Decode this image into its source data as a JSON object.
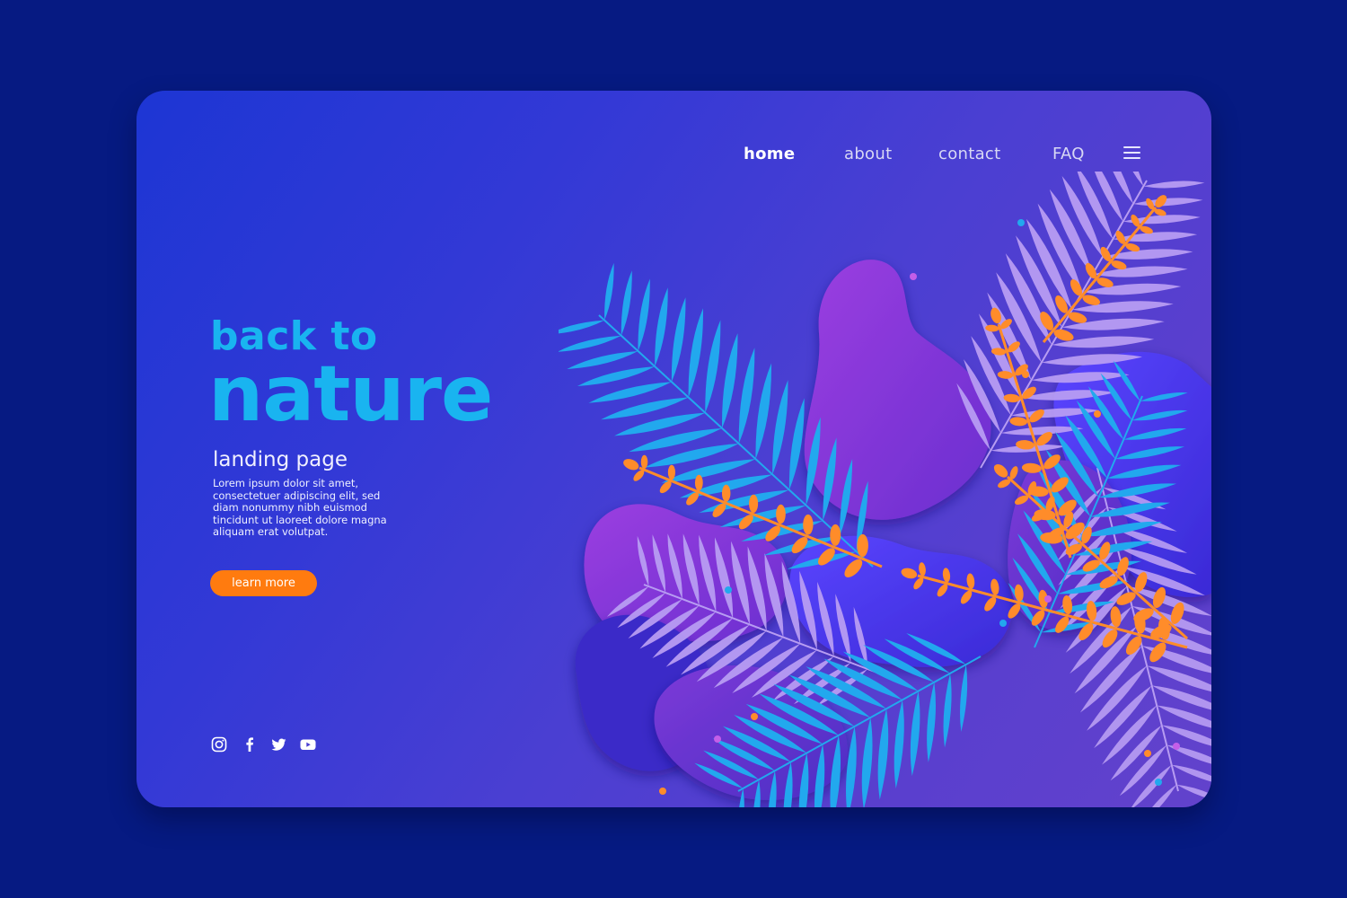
{
  "nav": {
    "items": [
      {
        "label": "home",
        "active": true
      },
      {
        "label": "about",
        "active": false
      },
      {
        "label": "contact",
        "active": false
      },
      {
        "label": "FAQ",
        "active": false
      }
    ],
    "menu_icon": "hamburger-menu-icon"
  },
  "hero": {
    "headline_line1": "back to",
    "headline_line2": "nature",
    "subtitle": "landing page",
    "description": "Lorem ipsum dolor sit amet, consectetuer adipiscing elit, sed diam nonummy nibh euismod tincidunt ut laoreet dolore magna aliquam erat volutpat.",
    "cta_label": "learn more"
  },
  "social": [
    "instagram-icon",
    "facebook-icon",
    "twitter-icon",
    "youtube-icon"
  ],
  "illustration": "tropical-leaves-illustration",
  "colors": {
    "page_background": "#061a82",
    "card_gradient_start": "#1d36d4",
    "card_gradient_end": "#6242cc",
    "headline": "#19b4f0",
    "cta": "#ff7b0f",
    "leaf_blue": "#22a8ee",
    "leaf_orange": "#ff8c2a",
    "leaf_lavender": "#b79cf2",
    "blob_purple": "#8a34d8"
  }
}
